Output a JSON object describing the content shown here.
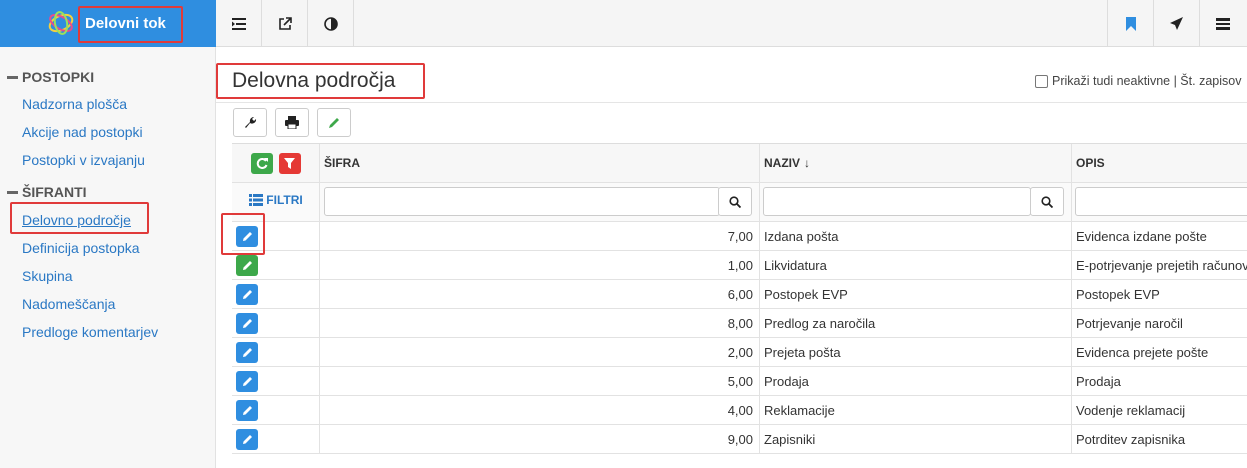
{
  "brand": {
    "title": "Delovni tok"
  },
  "topbar": {
    "left_icons": [
      "list-indent-icon",
      "external-link-icon",
      "contrast-icon"
    ],
    "right_icons": [
      "bookmark-icon",
      "send-icon",
      "menu-icon"
    ]
  },
  "sidebar": {
    "section1": "POSTOPKI",
    "section1_items": [
      "Nadzorna plošča",
      "Akcije nad postopki",
      "Postopki v izvajanju"
    ],
    "section2": "ŠIFRANTI",
    "section2_items": [
      "Delovno področje",
      "Definicija postopka",
      "Skupina",
      "Nadomeščanja",
      "Predloge komentarjev"
    ],
    "active_item": "Delovno področje"
  },
  "main": {
    "title": "Delovna področja",
    "inactive_label": "Prikaži tudi neaktivne | Št. zapisov"
  },
  "toolbar": {
    "buttons": [
      "wrench-icon",
      "print-icon",
      "pencil-icon"
    ]
  },
  "table": {
    "filters_label": "FILTRI",
    "columns": [
      "ŠIFRA",
      "NAZIV",
      "OPIS"
    ],
    "sort_indicator": "↓",
    "rows": [
      {
        "sifra": "7,00",
        "naziv": "Izdana pošta",
        "opis": "Evidenca izdane pošte",
        "edit": "blue"
      },
      {
        "sifra": "1,00",
        "naziv": "Likvidatura",
        "opis": "E-potrjevanje prejetih računov",
        "edit": "green"
      },
      {
        "sifra": "6,00",
        "naziv": "Postopek EVP",
        "opis": "Postopek EVP",
        "edit": "blue"
      },
      {
        "sifra": "8,00",
        "naziv": "Predlog za naročila",
        "opis": "Potrjevanje naročil",
        "edit": "blue"
      },
      {
        "sifra": "2,00",
        "naziv": "Prejeta pošta",
        "opis": "Evidenca prejete pošte",
        "edit": "blue"
      },
      {
        "sifra": "5,00",
        "naziv": "Prodaja",
        "opis": "Prodaja",
        "edit": "blue"
      },
      {
        "sifra": "4,00",
        "naziv": "Reklamacije",
        "opis": "Vodenje reklamacij",
        "edit": "blue"
      },
      {
        "sifra": "9,00",
        "naziv": "Zapisniki",
        "opis": "Potrditev zapisnika",
        "edit": "blue"
      }
    ]
  },
  "colors": {
    "accent": "#2f8ee0",
    "green": "#3da84a",
    "red": "#e53935",
    "highlight": "#e03a3a"
  }
}
